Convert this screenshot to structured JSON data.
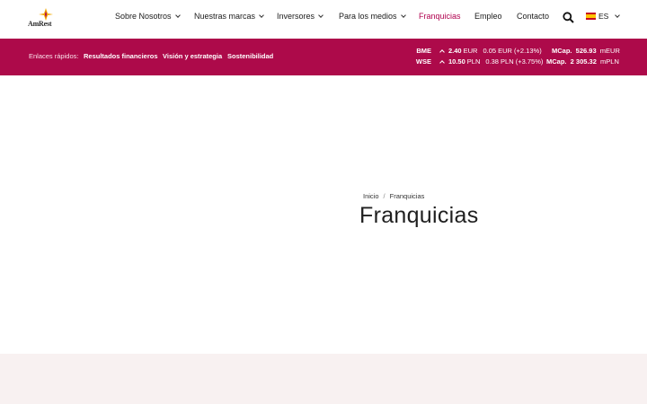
{
  "logo": {
    "text": "AmRest"
  },
  "nav": [
    {
      "label": "Sobre Nosotros",
      "dropdown": true
    },
    {
      "label": "Nuestras marcas",
      "dropdown": true
    },
    {
      "label": "Inversores",
      "dropdown": true
    },
    {
      "label": "Para los medios",
      "dropdown": true
    },
    {
      "label": "Franquicias",
      "dropdown": false,
      "active": true
    },
    {
      "label": "Empleo",
      "dropdown": false
    },
    {
      "label": "Contacto",
      "dropdown": false
    }
  ],
  "language": {
    "code": "ES",
    "icon": "spain-flag-icon"
  },
  "quick_links": {
    "label": "Enlaces rápidos:",
    "links": [
      "Resultados financieros",
      "Visión y estrategia",
      "Sostenibilidad"
    ]
  },
  "stocks": [
    {
      "exchange": "BME",
      "price": "2.40",
      "currency": "EUR",
      "change": "0.05 EUR (+2.13%)",
      "mcap_label": "MCap.",
      "mcap_value": "526.93",
      "mcap_unit": "mEUR"
    },
    {
      "exchange": "WSE",
      "price": "10.50",
      "currency": "PLN",
      "change": "0.38 PLN (+3.75%)",
      "mcap_label": "MCap.",
      "mcap_value": "2 305.32",
      "mcap_unit": "mPLN"
    }
  ],
  "breadcrumb": {
    "home": "Inicio",
    "separator": "/",
    "current": "Franquicias"
  },
  "page": {
    "title": "Franquicias"
  },
  "colors": {
    "brand": "#ad0a4a",
    "active_nav": "#b0004e",
    "footer_band": "#f8f1f1"
  }
}
